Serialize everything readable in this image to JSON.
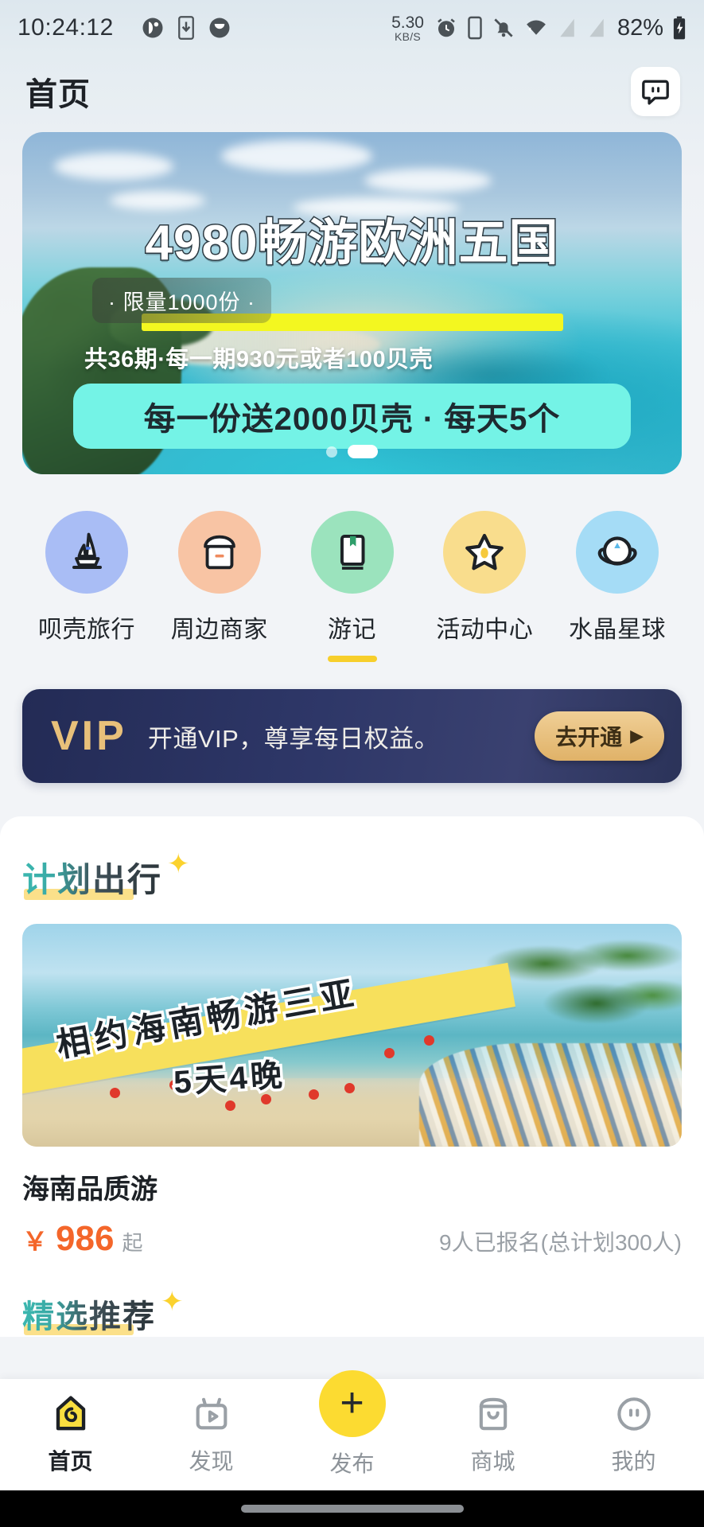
{
  "status_bar": {
    "time": "10:24:12",
    "network_speed_value": "5.30",
    "network_speed_unit": "KB/S",
    "battery_percent": "82%",
    "icons": [
      "app-circle-icon",
      "download-icon",
      "moon-circle-icon",
      "alarm-icon",
      "vibrate-icon",
      "bell-muted-icon",
      "wifi-icon",
      "signal-bars-icon",
      "signal-bars-icon",
      "battery-charging-icon"
    ]
  },
  "header": {
    "title": "首页",
    "chat_icon": "chat-bubble-icon"
  },
  "hero_banner": {
    "title": "4980畅游欧洲五国",
    "badge": "· 限量1000份 ·",
    "subtitle": "共36期·每一期930元或者100贝壳",
    "pill": "每一份送2000贝壳 · 每天5个",
    "dots_total": 2,
    "dots_active_index": 1,
    "highlight_color": "#f3f720",
    "pill_color": "#74f3e6"
  },
  "categories": [
    {
      "label": "呗壳旅行",
      "icon": "sailboat-icon",
      "bg": "#a9bdf5",
      "active": false
    },
    {
      "label": "周边商家",
      "icon": "shop-icon",
      "bg": "#f8c4a4",
      "active": false
    },
    {
      "label": "游记",
      "icon": "book-icon",
      "bg": "#9be3bd",
      "active": true
    },
    {
      "label": "活动中心",
      "icon": "star-icon",
      "bg": "#f9dd8d",
      "active": false
    },
    {
      "label": "水晶星球",
      "icon": "planet-icon",
      "bg": "#a5dcf6",
      "active": false
    }
  ],
  "vip_banner": {
    "logo": "VIP",
    "text": "开通VIP，尊享每日权益。",
    "button_label": "去开通",
    "button_caret": "▶",
    "accent_color": "#e8c07a",
    "bg_color": "#2e3768"
  },
  "plan_section": {
    "title": "计划出行",
    "sparkle": "✦",
    "trip": {
      "image_text_line1": "相约海南畅游三亚",
      "image_text_line2": "5天4晚",
      "name": "海南品质游",
      "price_symbol": "￥",
      "price_value": "986",
      "price_suffix": "起",
      "signup_status": "9人已报名(总计划300人)",
      "price_color": "#f4662a"
    }
  },
  "next_section": {
    "title": "精选推荐",
    "sparkle": "✦"
  },
  "tabbar": {
    "items": [
      {
        "label": "首页",
        "icon": "home-shell-icon",
        "active": true
      },
      {
        "label": "发现",
        "icon": "discover-tv-icon",
        "active": false
      },
      {
        "label": "发布",
        "icon": "plus-icon",
        "active": false,
        "is_fab": true
      },
      {
        "label": "商城",
        "icon": "shop-bag-icon",
        "active": false
      },
      {
        "label": "我的",
        "icon": "profile-face-icon",
        "active": false
      }
    ],
    "fab_color": "#fcdb31"
  }
}
